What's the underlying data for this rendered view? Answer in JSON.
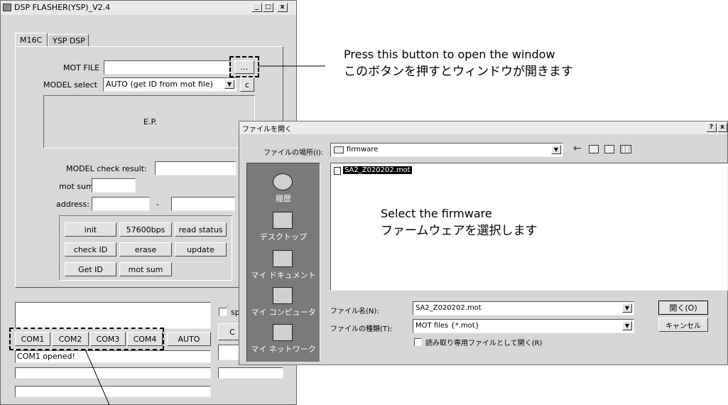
{
  "main_window": {
    "title": "DSP FLASHER(YSP)_V2.4",
    "controls": {
      "minimize": "_",
      "maximize": "□",
      "close": "x"
    },
    "tabs": [
      {
        "label": "M16C"
      },
      {
        "label": "YSP DSP"
      }
    ],
    "mot_file_label": "MOT FILE",
    "browse_label": "...",
    "model_select_label": "MODEL select",
    "model_select_value": "AUTO (get ID from mot file)",
    "model_c_label": "c",
    "ep_label": "E.P.",
    "model_check_label": "MODEL check result:",
    "mot_sum_label": "mot sum:",
    "address_label": "address:",
    "address_dash": "-",
    "buttons": {
      "init": "init",
      "baud": "57600bps",
      "read_status": "read status",
      "check_id": "check ID",
      "erase": "erase",
      "update": "update",
      "get_id": "Get ID",
      "mot_sum": "mot sum"
    },
    "sp_label": "sp",
    "c_button_label": "C",
    "com_buttons": [
      "COM1",
      "COM2",
      "COM3",
      "COM4"
    ],
    "auto_label": "AUTO",
    "status_text": "COM1 opened!"
  },
  "open_dialog": {
    "title": "ファイルを開く",
    "help": "?",
    "close": "x",
    "look_in_label": "ファイルの場所(I):",
    "look_in_value": "firmware",
    "places": [
      "履歴",
      "デスクトップ",
      "マイ ドキュメント",
      "マイ コンピュータ",
      "マイ ネットワーク"
    ],
    "files": [
      "SA2_Z020202.mot"
    ],
    "filename_label": "ファイル名(N):",
    "filename_value": "SA2_Z020202.mot",
    "filetype_label": "ファイルの種類(T):",
    "filetype_value": "MOT files {*.mot}",
    "readonly_label": "読み取り専用ファイルとして開く(R)",
    "open_button": "開く(O)",
    "cancel_button": "キャンセル"
  },
  "annotations": {
    "press_en": "Press this button to open the window",
    "press_ja": "このボタンを押すとウィンドウが開きます",
    "select_en": "Select the firmware",
    "select_ja": "ファームウェアを選択します"
  }
}
